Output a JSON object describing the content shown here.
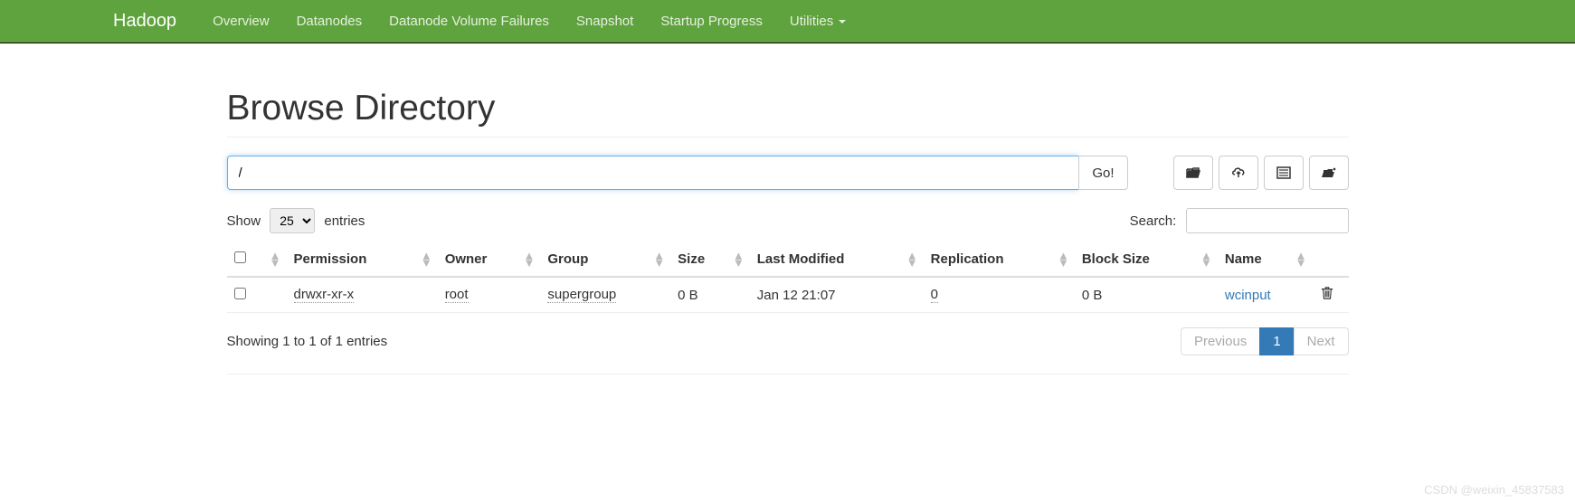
{
  "nav": {
    "brand": "Hadoop",
    "items": [
      "Overview",
      "Datanodes",
      "Datanode Volume Failures",
      "Snapshot",
      "Startup Progress",
      "Utilities"
    ]
  },
  "page": {
    "title": "Browse Directory",
    "path_value": "/",
    "go_label": "Go!"
  },
  "datatable": {
    "show_label": "Show",
    "entries_label": "entries",
    "length_value": "25",
    "search_label": "Search:",
    "search_value": "",
    "columns": [
      "Permission",
      "Owner",
      "Group",
      "Size",
      "Last Modified",
      "Replication",
      "Block Size",
      "Name"
    ],
    "rows": [
      {
        "permission": "drwxr-xr-x",
        "owner": "root",
        "group": "supergroup",
        "size": "0 B",
        "last_modified": "Jan 12 21:07",
        "replication": "0",
        "block_size": "0 B",
        "name": "wcinput"
      }
    ],
    "info": "Showing 1 to 1 of 1 entries",
    "pagination": {
      "previous": "Previous",
      "current": "1",
      "next": "Next"
    }
  },
  "icons": {
    "folder": "folder-open-icon",
    "upload": "upload-icon",
    "list": "list-icon",
    "refresh": "cut-icon"
  },
  "watermark": "CSDN @weixin_45837583"
}
